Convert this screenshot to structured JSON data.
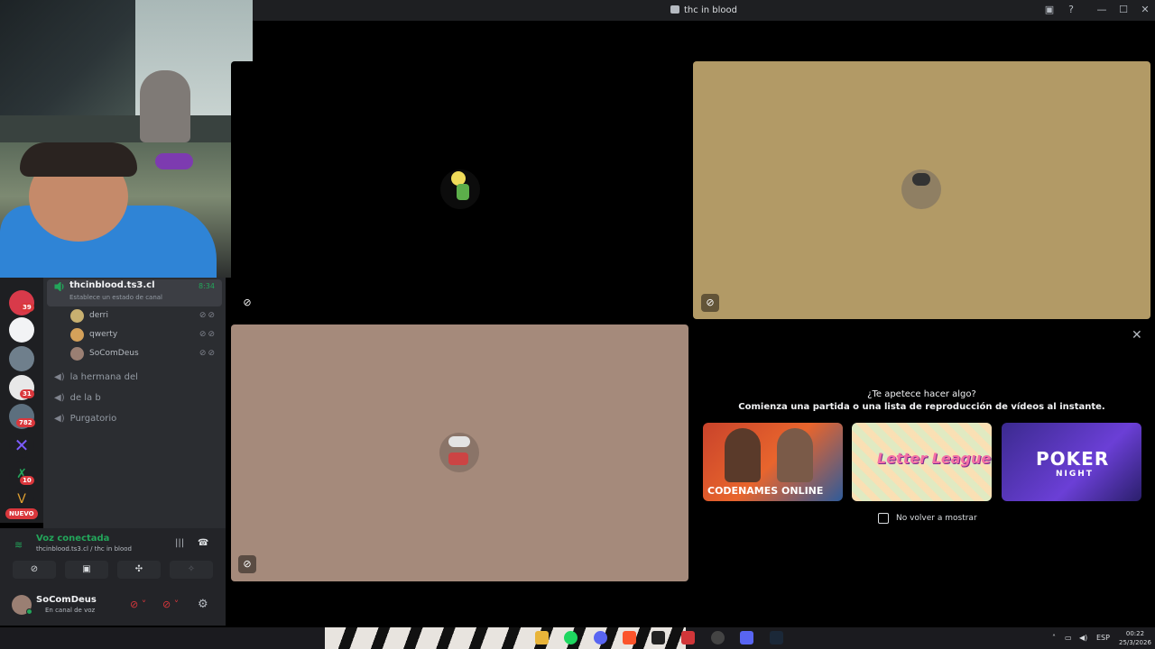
{
  "window": {
    "title": "thc in blood"
  },
  "sidebar": {
    "voice_channel": {
      "name": "thcinblood.ts3.cl",
      "time": "8:34",
      "status": "Establece un estado de canal"
    },
    "members": [
      {
        "name": "derri"
      },
      {
        "name": "qwerty"
      },
      {
        "name": "SoComDeus"
      }
    ],
    "channels": [
      {
        "name": "la hermana del"
      },
      {
        "name": "de la b"
      },
      {
        "name": "Purgatorio"
      }
    ],
    "server_badges": [
      "39",
      "31",
      "782",
      "10"
    ],
    "new_label": "NUEVO"
  },
  "voice_panel": {
    "title": "Voz conectada",
    "subtitle": "thcinblood.ts3.cl / thc in blood"
  },
  "user": {
    "name": "SoComDeus",
    "status": "En canal de voz"
  },
  "activity": {
    "question": "¿Te apetece hacer algo?",
    "prompt": "Comienza una partida o una lista de reproducción de vídeos al instante.",
    "cards": [
      {
        "name": "CODENAMES ONLINE"
      },
      {
        "name": "Letter League"
      },
      {
        "name": "POKER",
        "sub": "NIGHT"
      }
    ],
    "dont_show": "No volver a mostrar"
  },
  "taskbar": {
    "lang": "ESP",
    "time": "00:22",
    "date": "25/3/2026"
  },
  "colors": {
    "accent_green": "#23a55a",
    "danger": "#da373c",
    "tile_tan": "#b29a66",
    "tile_rose": "#a58a7b"
  }
}
